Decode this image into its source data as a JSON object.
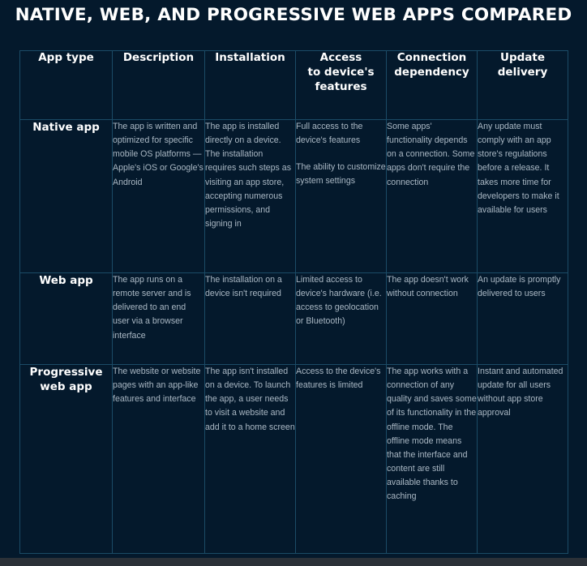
{
  "title": "NATIVE, WEB, AND PROGRESSIVE WEB APPS COMPARED",
  "colors": {
    "background": "#04192c",
    "border": "#1b4b66",
    "heading_text": "#ffffff",
    "body_text": "#aab8c4",
    "bottom_strip": "#2b3138"
  },
  "table": {
    "headers": [
      "App type",
      "Description",
      "Installation",
      "Access\nto device's\nfeatures",
      "Connection\ndependency",
      "Update\ndelivery"
    ],
    "headers_lines": {
      "h0": [
        "App type"
      ],
      "h1": [
        "Description"
      ],
      "h2": [
        "Installation"
      ],
      "h3": [
        "Access",
        "to device's",
        "features"
      ],
      "h4": [
        "Connection",
        "dependency"
      ],
      "h5": [
        "Update",
        "delivery"
      ]
    },
    "rows": [
      {
        "label": "Native app",
        "description": [
          "The app is written and optimized for specific mobile OS platforms — Apple's iOS or Google's Android"
        ],
        "installation": [
          "The app is installed directly on a device. The installation requires such steps as visiting an app store, accepting numerous permissions, and signing in"
        ],
        "access": [
          "Full access to the device's features",
          "The ability to customize system settings"
        ],
        "connection": [
          "Some apps' functionality depends on a connection. Some apps don't require the connection"
        ],
        "update": [
          "Any update must comply with an app store's regulations before a release. It takes more time for developers to make it available for users"
        ]
      },
      {
        "label": "Web app",
        "description": [
          "The app runs on a remote server and is delivered to an end user via a browser interface"
        ],
        "installation": [
          "The installation on a device isn't required"
        ],
        "access": [
          "Limited access to device's hardware (i.e. access to geolocation or Bluetooth)"
        ],
        "connection": [
          "The app doesn't work without connection"
        ],
        "update": [
          "An update is promptly delivered to users"
        ]
      },
      {
        "label": "Progressive web app",
        "description": [
          "The website or website pages with an app-like features and interface"
        ],
        "installation": [
          "The app isn't installed on a device. To launch the app, a user needs to visit a website and add it to a home screen"
        ],
        "access": [
          "Access to the device's features is limited"
        ],
        "connection": [
          "The app works with a connection of any quality and saves some of its functionality in the offline mode. The offline mode means that the interface and content are still available thanks to caching"
        ],
        "update": [
          "Instant and automated update for all users without app store approval"
        ]
      }
    ]
  }
}
